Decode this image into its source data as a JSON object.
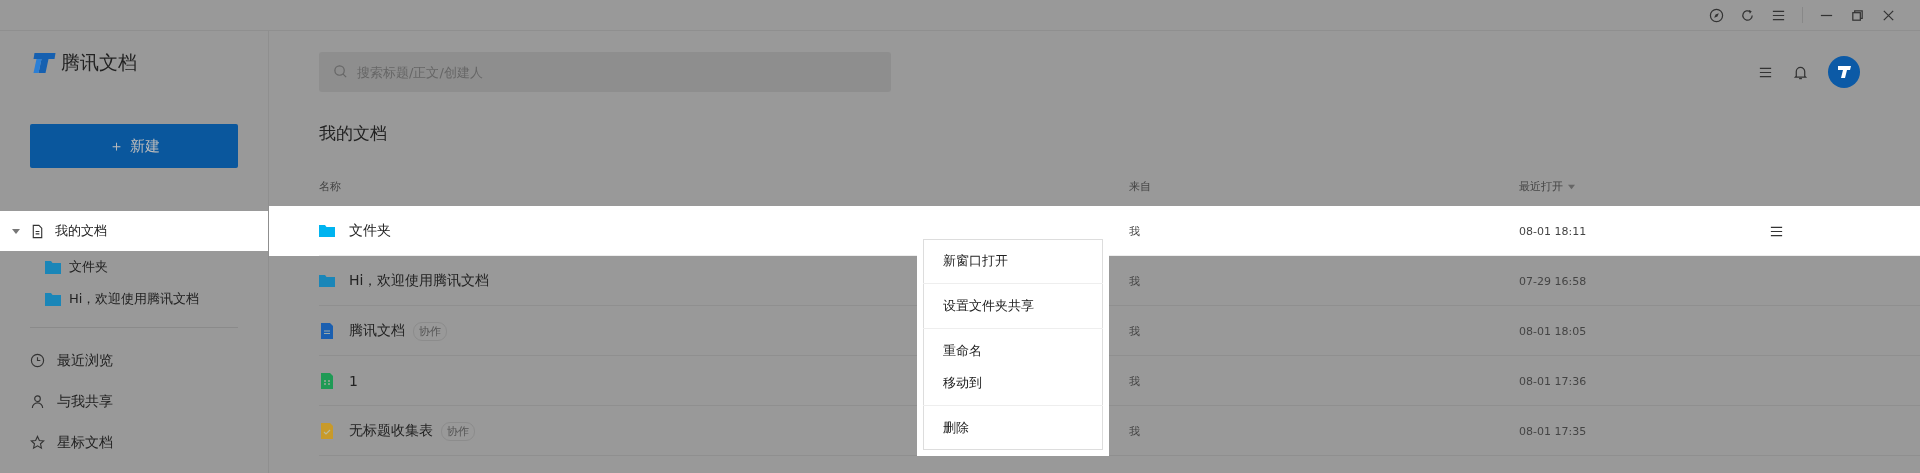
{
  "app": {
    "name": "腾讯文档"
  },
  "sidebar": {
    "new_button_icon": "＋",
    "new_button": "新建",
    "tree": [
      {
        "label": "我的文档",
        "expanded": true,
        "selected": true,
        "children": [
          {
            "label": "文件夹",
            "selected": false
          },
          {
            "label": "Hi，欢迎使用腾讯文档",
            "selected": false
          }
        ]
      }
    ],
    "nav": [
      {
        "label": "最近浏览",
        "kind": "recent"
      },
      {
        "label": "与我共享",
        "kind": "shared"
      },
      {
        "label": "星标文档",
        "kind": "starred"
      }
    ]
  },
  "search": {
    "placeholder": "搜索标题/正文/创建人"
  },
  "heading": "我的文档",
  "table": {
    "columns": [
      "名称",
      "来自",
      "最近打开"
    ],
    "rows": [
      {
        "kind": "folder",
        "name": "文件夹",
        "from": "我",
        "opened": "08-01 18:11",
        "selected": true
      },
      {
        "kind": "folder",
        "name": "Hi，欢迎使用腾讯文档",
        "from": "我",
        "opened": "07-29 16:58",
        "selected": false
      },
      {
        "kind": "doc",
        "name": "腾讯文档",
        "tag": "协作",
        "from": "我",
        "opened": "08-01 18:05",
        "selected": false
      },
      {
        "kind": "sheet",
        "name": "1",
        "from": "我",
        "opened": "08-01 17:36",
        "selected": false
      },
      {
        "kind": "form",
        "name": "无标题收集表",
        "tag": "协作",
        "from": "我",
        "opened": "08-01 17:35",
        "selected": false
      }
    ]
  },
  "context_menu": {
    "groups": [
      [
        "新窗口打开"
      ],
      [
        "设置文件夹共享"
      ],
      [
        "重命名",
        "移动到"
      ],
      [
        "删除"
      ]
    ]
  }
}
